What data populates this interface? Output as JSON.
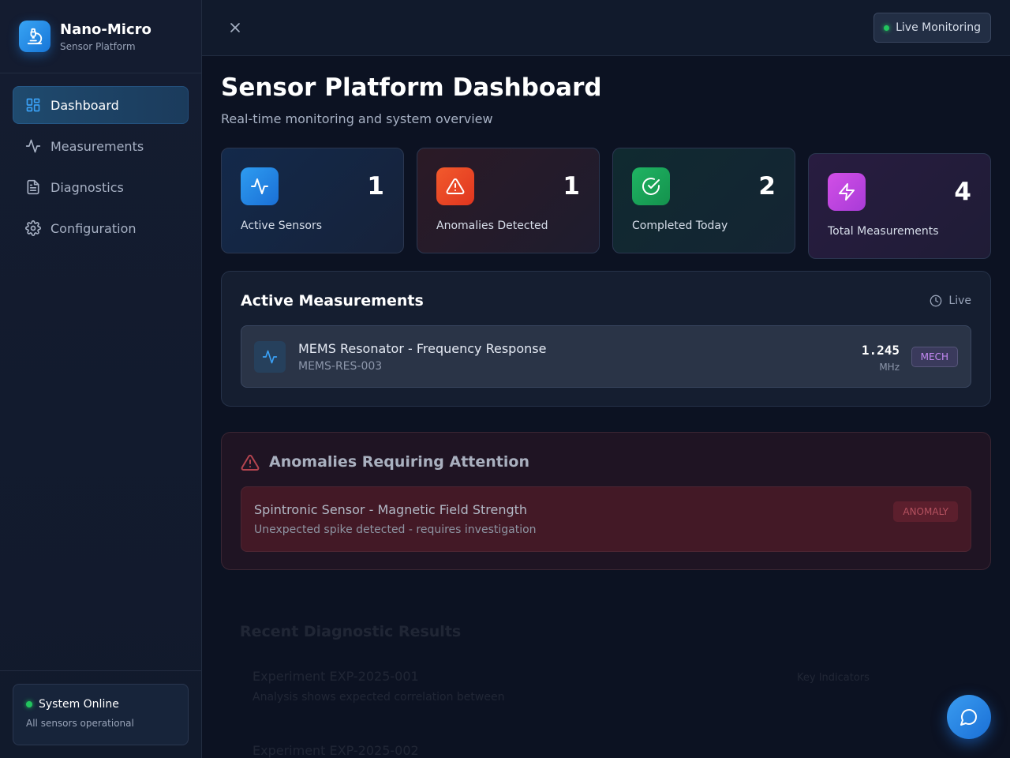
{
  "brand": {
    "title": "Nano-Micro",
    "subtitle": "Sensor Platform"
  },
  "nav": {
    "items": [
      {
        "label": "Dashboard",
        "icon": "dashboard-icon",
        "active": true
      },
      {
        "label": "Measurements",
        "icon": "activity-icon"
      },
      {
        "label": "Diagnostics",
        "icon": "document-icon"
      },
      {
        "label": "Configuration",
        "icon": "gear-icon"
      }
    ]
  },
  "system_status": {
    "label": "System Online",
    "detail": "All sensors operational"
  },
  "topbar": {
    "live_label": "Live Monitoring"
  },
  "page": {
    "title": "Sensor Platform Dashboard",
    "subtitle": "Real-time monitoring and system overview"
  },
  "stats": [
    {
      "value": "1",
      "label": "Active Sensors",
      "icon": "activity-icon",
      "color": "#1e88e5"
    },
    {
      "value": "1",
      "label": "Anomalies Detected",
      "icon": "warning-icon",
      "color": "#ef4f24"
    },
    {
      "value": "2",
      "label": "Completed Today",
      "icon": "check-circle-icon",
      "color": "#16a34a"
    },
    {
      "value": "4",
      "label": "Total Measurements",
      "icon": "lightning-icon",
      "color": "#c043e0"
    }
  ],
  "active_measurements": {
    "title": "Active Measurements",
    "live_label": "Live",
    "items": [
      {
        "name": "MEMS Resonator - Frequency Response",
        "id": "MEMS-RES-003",
        "value": "1.245",
        "unit": "MHz",
        "badge": "MECH"
      }
    ]
  },
  "anomalies": {
    "title": "Anomalies Requiring Attention",
    "items": [
      {
        "name": "Spintronic Sensor - Magnetic Field Strength",
        "description": "Unexpected spike detected - requires investigation",
        "badge": "ANOMALY"
      }
    ]
  },
  "recent_results": {
    "title": "Recent Diagnostic Results",
    "items": [
      {
        "name": "Experiment EXP-2025-001",
        "description": "Analysis shows expected correlation between",
        "status": "Key Indicators"
      },
      {
        "name": "Experiment EXP-2025-002"
      }
    ]
  }
}
